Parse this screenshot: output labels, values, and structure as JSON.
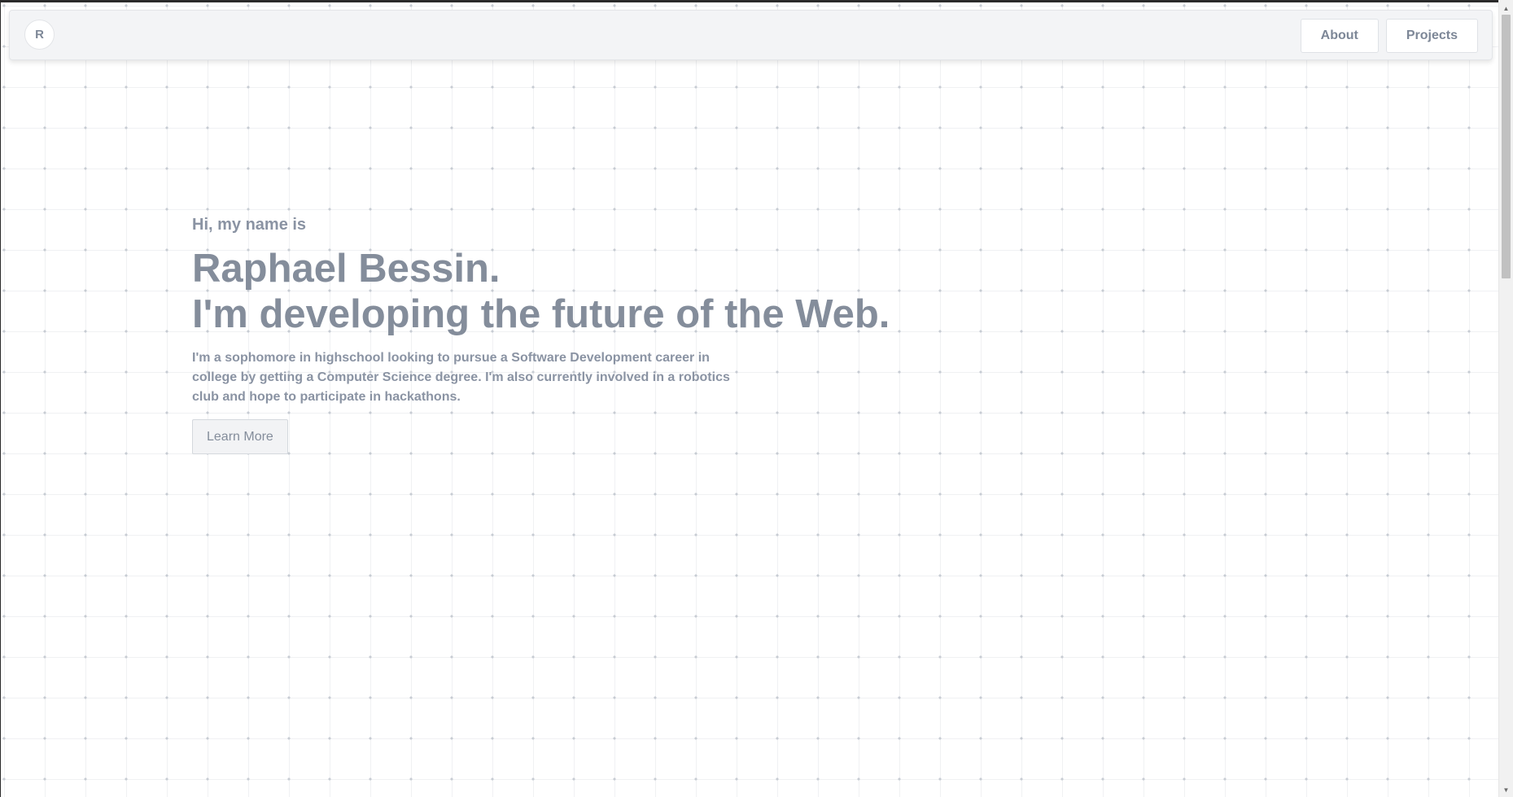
{
  "navbar": {
    "logo_letter": "R",
    "links": [
      {
        "label": "About"
      },
      {
        "label": "Projects"
      }
    ]
  },
  "hero": {
    "greeting": "Hi, my name is",
    "headline_line1": "Raphael Bessin.",
    "headline_line2": "I'm developing the future of the Web.",
    "bio": "I'm a sophomore in highschool looking to pursue a Software Development career in college by getting a Computer Science degree. I'm also currently involved in a robotics club and hope to participate in hackathons.",
    "cta_label": "Learn More"
  },
  "scrollbar": {
    "up_icon": "triangle-up",
    "down_icon": "triangle-down"
  },
  "colors": {
    "text_muted": "#848d9b",
    "navbar_bg": "#f3f4f6",
    "grid_dot": "#c7ccd3"
  }
}
